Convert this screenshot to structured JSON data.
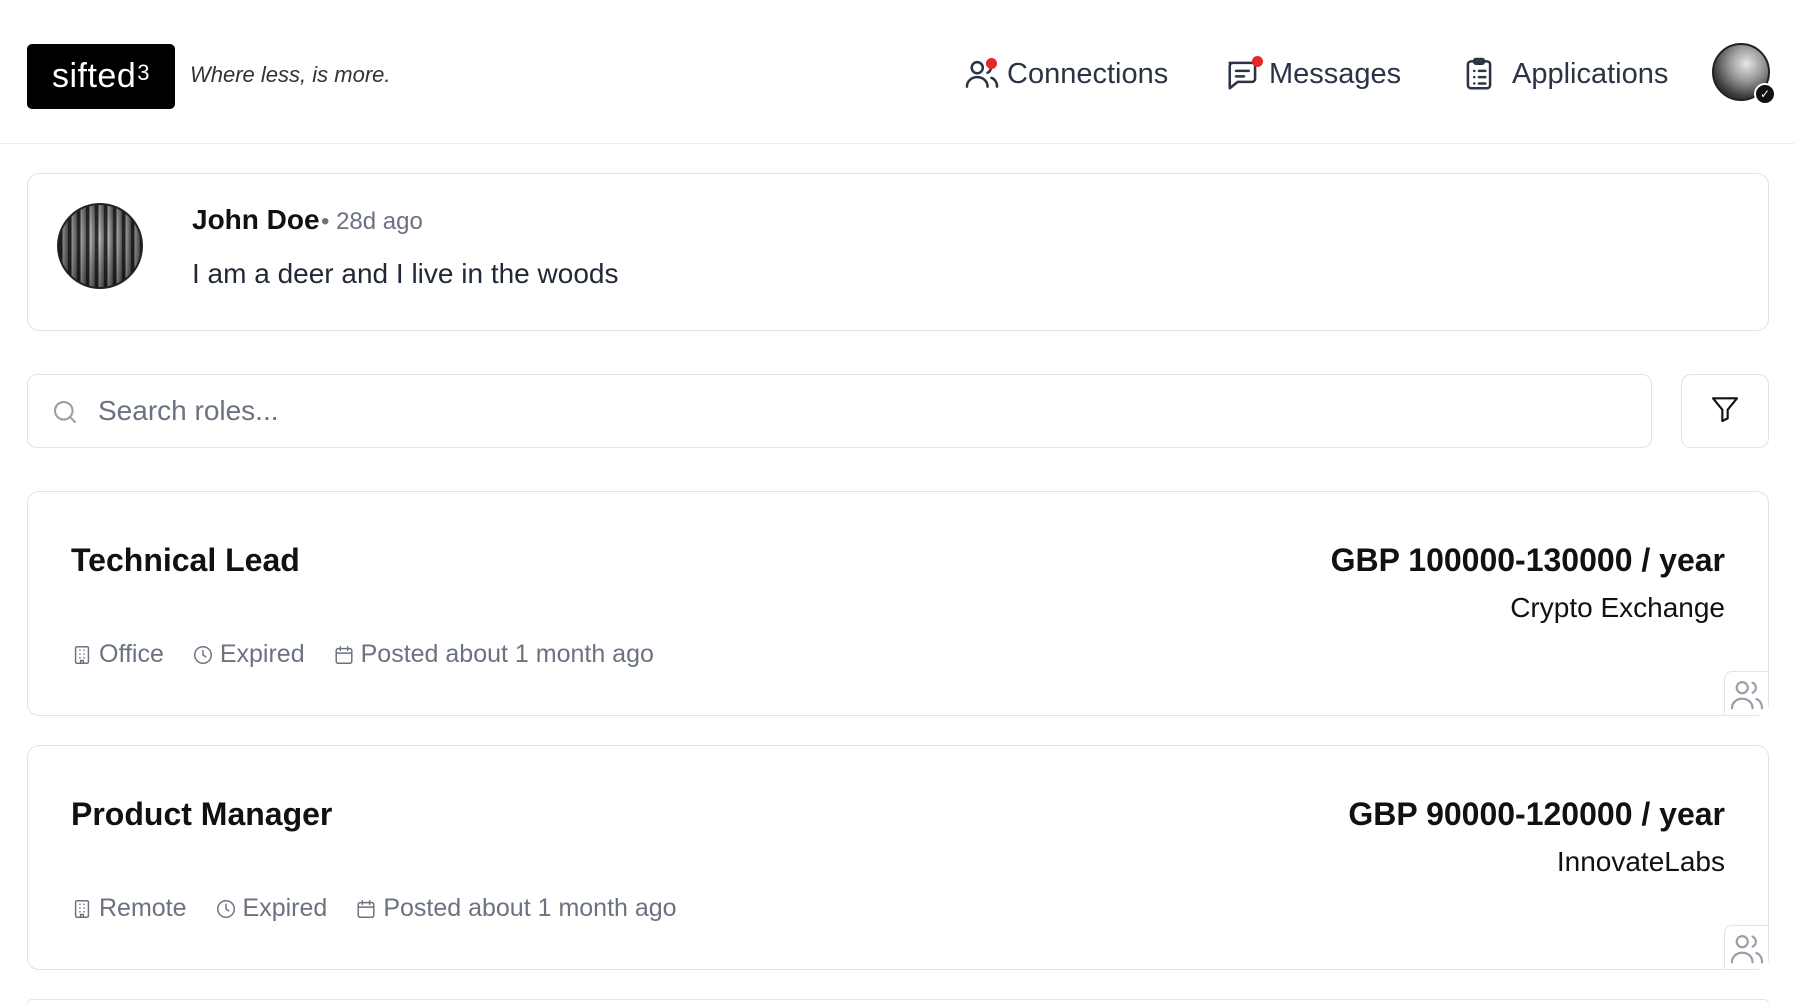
{
  "header": {
    "logo_text": "sifted",
    "logo_sup": "3",
    "tagline": "Where less, is more.",
    "nav": {
      "connections": "Connections",
      "messages": "Messages",
      "applications": "Applications"
    },
    "notification_color": "#e5262b",
    "avatar_check": "✓"
  },
  "post": {
    "author": "John Doe",
    "time": "• 28d ago",
    "text": "I am a deer and I live in the woods"
  },
  "search": {
    "placeholder": "Search roles..."
  },
  "jobs": [
    {
      "title": "Technical Lead",
      "salary": "GBP 100000-130000 / year",
      "company": "Crypto Exchange",
      "location": "Office",
      "status": "Expired",
      "posted": "Posted about 1 month ago"
    },
    {
      "title": "Product Manager",
      "salary": "GBP 90000-120000 / year",
      "company": "InnovateLabs",
      "location": "Remote",
      "status": "Expired",
      "posted": "Posted about 1 month ago"
    }
  ],
  "icons": {
    "connections": "users-icon",
    "messages": "message-icon",
    "applications": "clipboard-icon",
    "search": "search-icon",
    "filter": "filter-icon",
    "location": "building-icon",
    "status": "clock-icon",
    "posted": "calendar-icon",
    "apply": "users-icon"
  }
}
